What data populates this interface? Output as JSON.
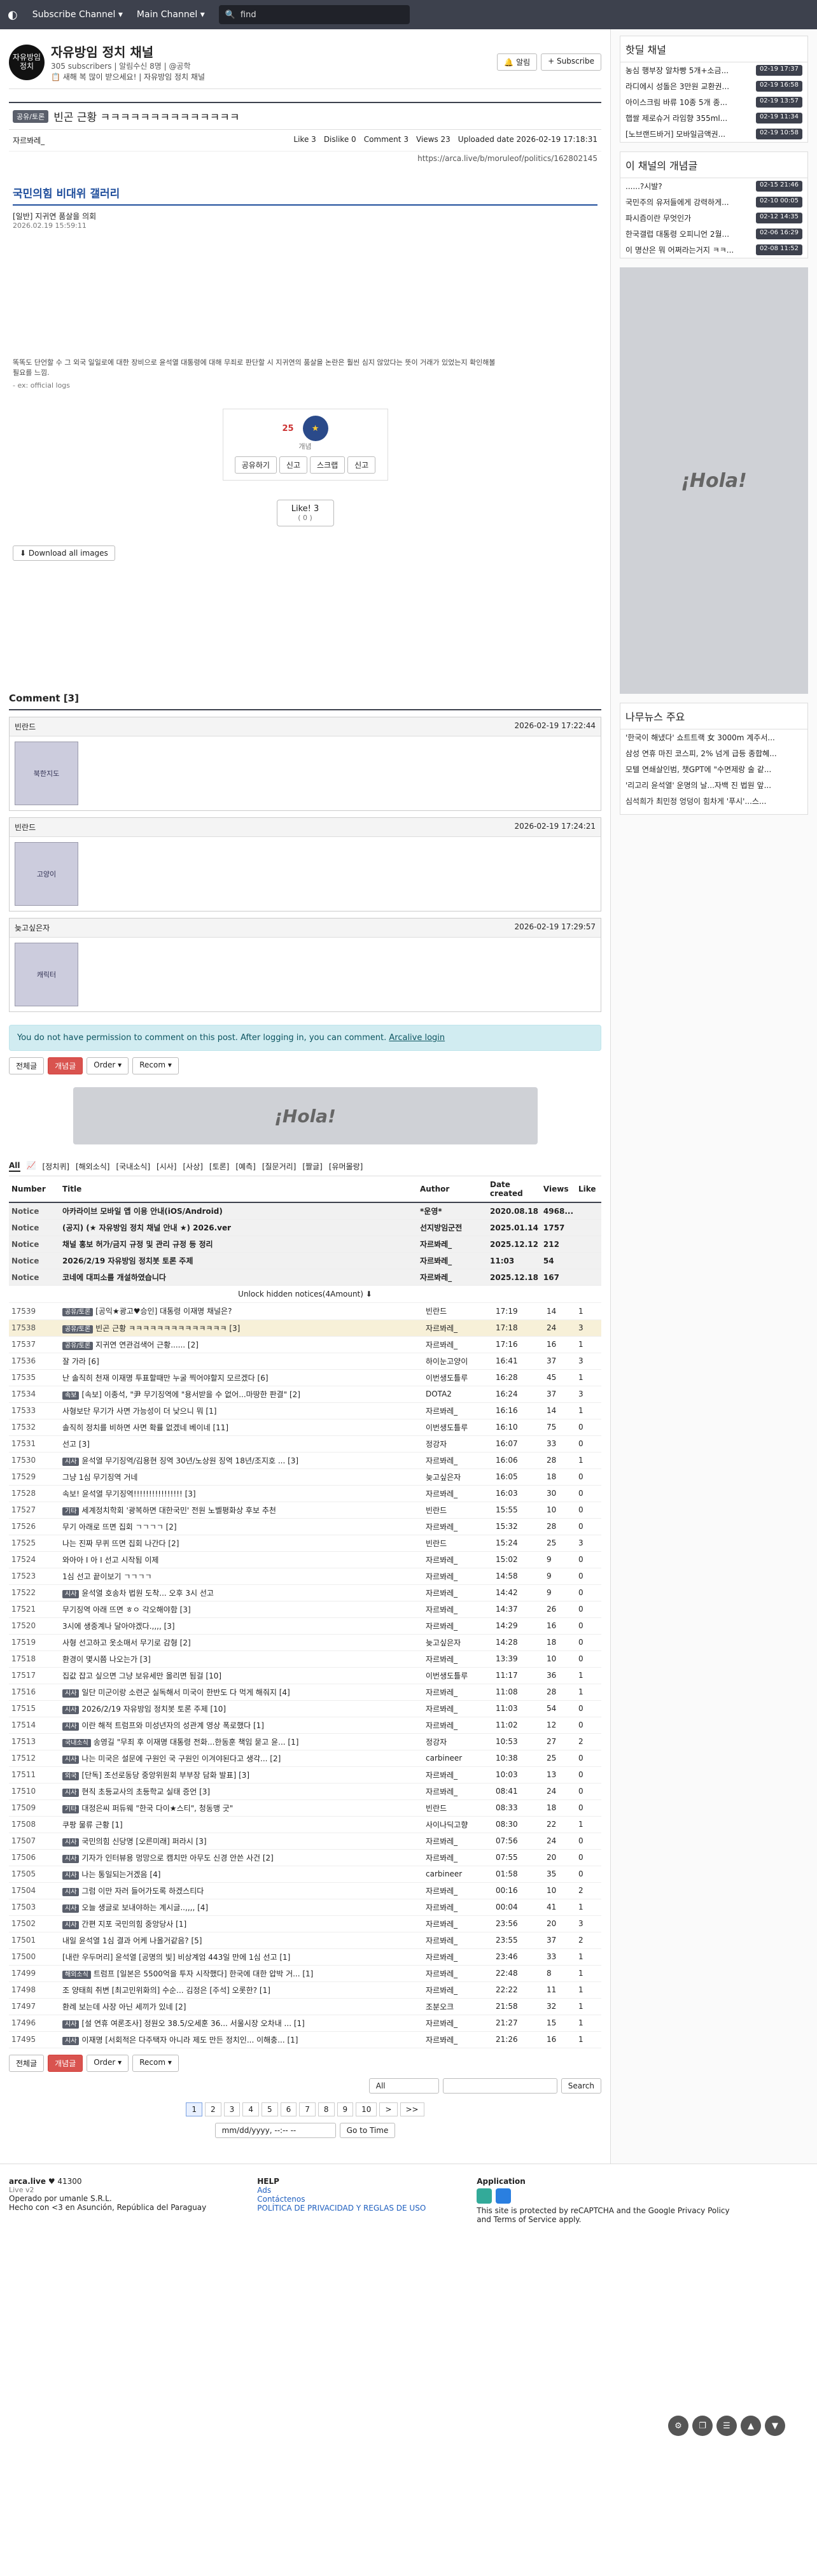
{
  "topbar": {
    "logo": "arca.live",
    "menu1": "Subscribe Channel ▾",
    "menu2": "Main Channel ▾",
    "search_placeholder": "find"
  },
  "channel": {
    "logo_text": "자유방임\n정치",
    "title": "자유방임 정치 채널",
    "subscribers": "305 subscribers",
    "sub_extra": "알림수신 8명 | @공학",
    "desc": "새해 복 많이 받으세요! | 자유방임 정치 채널",
    "alarm_btn": "알림",
    "subscribe_btn": "+ Subscribe"
  },
  "article": {
    "badge": "공유/토론",
    "title": "빈곤 근황 ㅋㅋㅋㅋㅋㅋㅋㅋㅋㅋㅋㅋㅋㅋ",
    "author": "자르봐레_",
    "like_label": "Like",
    "like_count": "3",
    "dislike_label": "Dislike",
    "dislike_count": "0",
    "comment_label": "Comment",
    "comment_count": "3",
    "views_label": "Views",
    "views_count": "23",
    "uploaded_label": "Uploaded date",
    "uploaded": "2026-02-19 17:18:31",
    "url": "https://arca.live/b/moruleof/politics/162802145",
    "inner_title": "국민의힘 비대위 갤러리",
    "inner_sub": "[일반] 지귀연 품살을 의회",
    "inner_date": "2026.02.19 15:59:11",
    "inner_text": "똑똑도 단언할 수 그 외국 일일로에 대한 장비으로 윤석열 대통령에 대해 무죄로 판단할 시 지귀연의 품살을 논란은 훨씬 심지 않았다는 뜻이 거래가 있었는지 확인해볼 필요를 느낌.",
    "inner_src": "- ex: official logs",
    "vote_num": "25",
    "vote_label": "개념",
    "vote_btns": [
      "공유하기",
      "신고",
      "스크랩",
      "신고"
    ],
    "like_box_label": "Like!",
    "like_box_count": "3",
    "like_box_sub": "( 0 )",
    "download_btn": "Download all images"
  },
  "comments": {
    "title": "Comment [3]",
    "items": [
      {
        "author": "빈란드",
        "date": "2026-02-19 17:22:44",
        "img": "북한지도"
      },
      {
        "author": "빈란드",
        "date": "2026-02-19 17:24:21",
        "img": "고양이"
      },
      {
        "author": "늦고싶은자",
        "date": "2026-02-19 17:29:57",
        "img": "캐릭터"
      }
    ],
    "alert": "You do not have permission to comment on this post. After logging in, you can comment.",
    "alert_link": "Arcalive login"
  },
  "toolbar": {
    "all": "전체글",
    "concept": "개념글",
    "order": "Order ▾",
    "recom": "Recom ▾"
  },
  "ad_text": "¡Hola!",
  "categories": [
    "All",
    "📈",
    "[정치퀴]",
    "[해외소식]",
    "[국내소식]",
    "[시사]",
    "[사상]",
    "[토론]",
    "[예측]",
    "[질문거리]",
    "[짤글]",
    "[유머몰랑]"
  ],
  "table": {
    "headers": [
      "Number",
      "Title",
      "Author",
      "Date created",
      "Views",
      "Like"
    ],
    "notices": [
      {
        "num": "Notice",
        "title": "아카라이브 모바일 앱 이용 안내(iOS/Android)",
        "author": "*운영*",
        "date": "2020.08.18",
        "views": "4968...",
        "like": ""
      },
      {
        "num": "Notice",
        "title": "(공지) (★ 자유방임 정치 채널 안내 ★) 2026.ver",
        "author": "선지방임군전",
        "date": "2025.01.14",
        "views": "1757",
        "like": ""
      },
      {
        "num": "Notice",
        "title": "채널 홍보 허가/금지 규정 및 관리 규정 등 정리",
        "author": "자르봐레_",
        "date": "2025.12.12",
        "views": "212",
        "like": ""
      },
      {
        "num": "Notice",
        "title": "2026/2/19 자유방임 정치봇 토론 주제",
        "author": "자르봐레_",
        "date": "11:03",
        "views": "54",
        "like": ""
      },
      {
        "num": "Notice",
        "title": "코네에 대피소를 개설하였습니다",
        "author": "자르봐레_",
        "date": "2025.12.18",
        "views": "167",
        "like": ""
      }
    ],
    "unlock": "Unlock hidden notices(4Amount) ⬇",
    "rows": [
      {
        "num": "17539",
        "tag": "공유/토론",
        "title": "[공익★광고♥승인] 대통령 이재명 채널은?",
        "author": "빈란드",
        "date": "17:19",
        "views": "14",
        "like": "1"
      },
      {
        "num": "17538",
        "tag": "공유/토론",
        "title": "빈곤 근황 ㅋㅋㅋㅋㅋㅋㅋㅋㅋㅋㅋㅋㅋㅋ [3]",
        "author": "자르봐레_",
        "date": "17:18",
        "views": "24",
        "like": "3",
        "hl": true
      },
      {
        "num": "17537",
        "tag": "공유/토론",
        "title": "지귀연 연관검색어 근황...... [2]",
        "author": "자르봐레_",
        "date": "17:16",
        "views": "16",
        "like": "1"
      },
      {
        "num": "17536",
        "tag": "",
        "title": "잘 가라 [6]",
        "author": "하이눈고양이",
        "date": "16:41",
        "views": "37",
        "like": "3"
      },
      {
        "num": "17535",
        "tag": "",
        "title": "난 솔직히 천재 이재명 투표할때만 누굴 찍어야할지 모르겠다 [6]",
        "author": "이번생도틀루",
        "date": "16:28",
        "views": "45",
        "like": "1"
      },
      {
        "num": "17534",
        "tag": "속보",
        "title": "[속보] 이종석, \"尹 무기징역에 \"용서받을 수 없어...마땅한 판결\" [2]",
        "author": "DOTA2",
        "date": "16:24",
        "views": "37",
        "like": "3"
      },
      {
        "num": "17533",
        "tag": "",
        "title": "사형보단 무기가 사면 가능성이 더 낮으니 뭐 [1]",
        "author": "자르봐레_",
        "date": "16:16",
        "views": "14",
        "like": "1"
      },
      {
        "num": "17532",
        "tag": "",
        "title": "솔직히 정치를 비하면 사면 확률 없겠네 베이네 [11]",
        "author": "이번생도틀루",
        "date": "16:10",
        "views": "75",
        "like": "0"
      },
      {
        "num": "17531",
        "tag": "",
        "title": "선고 [3]",
        "author": "정강자",
        "date": "16:07",
        "views": "33",
        "like": "0"
      },
      {
        "num": "17530",
        "tag": "시사",
        "title": "윤석열 무기징역/김용현 징역 30년/노상원 징역 18년/조지호 ... [3]",
        "author": "자르봐레_",
        "date": "16:06",
        "views": "28",
        "like": "1"
      },
      {
        "num": "17529",
        "tag": "",
        "title": "그냥 1심 무기징역 거네",
        "author": "늦고싶은자",
        "date": "16:05",
        "views": "18",
        "like": "0"
      },
      {
        "num": "17528",
        "tag": "",
        "title": "속보! 윤석열 무기징역!!!!!!!!!!!!!!!! [3]",
        "author": "자르봐레_",
        "date": "16:03",
        "views": "30",
        "like": "0"
      },
      {
        "num": "17527",
        "tag": "기타",
        "title": "세계정치학회 '광복하면 대한국민' 전원 노벨평화상 후보 추천",
        "author": "빈란드",
        "date": "15:55",
        "views": "10",
        "like": "0"
      },
      {
        "num": "17526",
        "tag": "",
        "title": "무기 아래로 뜨면 집회 ㄱㄱㄱㄱ [2]",
        "author": "자르봐레_",
        "date": "15:32",
        "views": "28",
        "like": "0"
      },
      {
        "num": "17525",
        "tag": "",
        "title": "나는 진짜 무퀴 뜨면 집회 나간다 [2]",
        "author": "빈란드",
        "date": "15:24",
        "views": "25",
        "like": "3"
      },
      {
        "num": "17524",
        "tag": "",
        "title": "와아아 I 아 I 선고 시작됨 이제",
        "author": "자르봐레_",
        "date": "15:02",
        "views": "9",
        "like": "0"
      },
      {
        "num": "17523",
        "tag": "",
        "title": "1심 선고 끝이보기 ㄱㄱㄱㄱ",
        "author": "자르봐레_",
        "date": "14:58",
        "views": "9",
        "like": "0"
      },
      {
        "num": "17522",
        "tag": "시사",
        "title": "윤석열 호송차 법원 도착... 오후 3시 선고",
        "author": "자르봐레_",
        "date": "14:42",
        "views": "9",
        "like": "0"
      },
      {
        "num": "17521",
        "tag": "",
        "title": "무기징역 아래 뜨면 ㅎㅇ 각오해야함 [3]",
        "author": "자르봐레_",
        "date": "14:37",
        "views": "26",
        "like": "0"
      },
      {
        "num": "17520",
        "tag": "",
        "title": "3시에 생중계나 달아야겠다.,,,, [3]",
        "author": "자르봐레_",
        "date": "14:29",
        "views": "16",
        "like": "0"
      },
      {
        "num": "17519",
        "tag": "",
        "title": "사형 선고하고 옷소매서 무기로 감형 [2]",
        "author": "늦고싶은자",
        "date": "14:28",
        "views": "18",
        "like": "0"
      },
      {
        "num": "17518",
        "tag": "",
        "title": "환경이 몇시쯤 나오는가 [3]",
        "author": "자르봐레_",
        "date": "13:39",
        "views": "10",
        "like": "0"
      },
      {
        "num": "17517",
        "tag": "",
        "title": "집값 잡고 싶으면 그냥 보유세만 올리면 됨걸 [10]",
        "author": "이번생도틀루",
        "date": "11:17",
        "views": "36",
        "like": "1"
      },
      {
        "num": "17516",
        "tag": "시사",
        "title": "일단 미군이랑 소련군 실독해서 미국이 한반도 다 먹게 해줘지 [4]",
        "author": "자르봐레_",
        "date": "11:08",
        "views": "28",
        "like": "1"
      },
      {
        "num": "17515",
        "tag": "시사",
        "title": "2026/2/19 자유방임 정치봇 토론 주제 [10]",
        "author": "자르봐레_",
        "date": "11:03",
        "views": "54",
        "like": "0"
      },
      {
        "num": "17514",
        "tag": "시사",
        "title": "이란 해적 트럼프와 미성년자의 성관계 영상 폭로했다 [1]",
        "author": "자르봐레_",
        "date": "11:02",
        "views": "12",
        "like": "0"
      },
      {
        "num": "17513",
        "tag": "국내소식",
        "title": "송영길 \"무죄 후 이재명 대통령 전화...한동훈 책임 묻고 윤... [1]",
        "author": "정강자",
        "date": "10:53",
        "views": "27",
        "like": "2"
      },
      {
        "num": "17512",
        "tag": "시사",
        "title": "나는 미국은 설문에 구원인 국 구원인 이겨야된다고 생각... [2]",
        "author": "carbineer",
        "date": "10:38",
        "views": "25",
        "like": "0"
      },
      {
        "num": "17511",
        "tag": "외국",
        "title": "[단독] 조선로동당 중앙위원회 부부장 담화 발표] [3]",
        "author": "자르봐레_",
        "date": "10:03",
        "views": "13",
        "like": "0"
      },
      {
        "num": "17510",
        "tag": "시사",
        "title": "현직 초등교사의 초등학교 실태 증언 [3]",
        "author": "자르봐레_",
        "date": "08:41",
        "views": "24",
        "like": "0"
      },
      {
        "num": "17509",
        "tag": "기타",
        "title": "대정은씨 퍼듀웨 \"한국 다이★스티\", 청동맹 굿\"",
        "author": "빈란드",
        "date": "08:33",
        "views": "18",
        "like": "0"
      },
      {
        "num": "17508",
        "tag": "",
        "title": "쿠팡 물류 근황 [1]",
        "author": "사이나딕고향",
        "date": "08:30",
        "views": "22",
        "like": "1"
      },
      {
        "num": "17507",
        "tag": "시사",
        "title": "국민의힘 신당명 [오른미래] 퍼라시 [3]",
        "author": "자르봐레_",
        "date": "07:56",
        "views": "24",
        "like": "0"
      },
      {
        "num": "17506",
        "tag": "시사",
        "title": "기자가 인터뷰용 멍망으로 캠치만 아무도 신경 안쓴 사건 [2]",
        "author": "자르봐레_",
        "date": "07:55",
        "views": "20",
        "like": "0"
      },
      {
        "num": "17505",
        "tag": "시사",
        "title": "나는 통일되는거겠음 [4]",
        "author": "carbineer",
        "date": "01:58",
        "views": "35",
        "like": "0"
      },
      {
        "num": "17504",
        "tag": "시사",
        "title": "그럼 이만 자러 들어가도록 하겠스티다",
        "author": "자르봐레_",
        "date": "00:16",
        "views": "10",
        "like": "2"
      },
      {
        "num": "17503",
        "tag": "시사",
        "title": "오늘 생글로 보내야하는 계시글..,,,, [4]",
        "author": "자르봐레_",
        "date": "00:04",
        "views": "41",
        "like": "1"
      },
      {
        "num": "17502",
        "tag": "시사",
        "title": "간편 지포 국민의힘 중앙당사 [1]",
        "author": "자르봐레_",
        "date": "23:56",
        "views": "20",
        "like": "3"
      },
      {
        "num": "17501",
        "tag": "",
        "title": "내일 윤석열 1심 결과 어케 나올거같음? [5]",
        "author": "자르봐레_",
        "date": "23:55",
        "views": "37",
        "like": "2"
      },
      {
        "num": "17500",
        "tag": "",
        "title": "[내란 우두머리] 윤석열 [공명의 빛] 비상계엄 443일 만에 1심 선고 [1]",
        "author": "자르봐레_",
        "date": "23:46",
        "views": "33",
        "like": "1"
      },
      {
        "num": "17499",
        "tag": "해외소식",
        "title": "트럼프 [일본은 5500억을 투자 시작했다] 한국에 대한 압박 거... [1]",
        "author": "자르봐레_",
        "date": "22:48",
        "views": "8",
        "like": "1"
      },
      {
        "num": "17498",
        "tag": "",
        "title": "조 양태희 취변 [최고민위화의] 수순... 김정은 [주석] 오롯한? [1]",
        "author": "자르봐레_",
        "date": "22:22",
        "views": "11",
        "like": "1"
      },
      {
        "num": "17497",
        "tag": "",
        "title": "환례 보는데 사장 아닌 세끼가 있네 [2]",
        "author": "조분오크",
        "date": "21:58",
        "views": "32",
        "like": "1"
      },
      {
        "num": "17496",
        "tag": "시사",
        "title": "[설 연휴 여론조사] 정원오 38.5/오세훈 36... 서울시장 오차내 ... [1]",
        "author": "자르봐레_",
        "date": "21:27",
        "views": "15",
        "like": "1"
      },
      {
        "num": "17495",
        "tag": "시사",
        "title": "이재명 [서회적은 다주택자 아니라 제도 만든 정치인... 이해충... [1]",
        "author": "자르봐레_",
        "date": "21:26",
        "views": "16",
        "like": "1"
      }
    ]
  },
  "search": {
    "select": "All",
    "button": "Search",
    "goto": "Go to Time",
    "date_placeholder": "mm/dd/yyyy, --:-- --"
  },
  "pager": [
    "1",
    "2",
    "3",
    "4",
    "5",
    "6",
    "7",
    "8",
    "9",
    "10",
    ">",
    ">>"
  ],
  "side": {
    "hot_title": "핫딜 채널",
    "hot": [
      {
        "t": "농심 행부장 알차빵 5개+소금...",
        "d": "02-19 17:37"
      },
      {
        "t": "라디에시 성돌은 3만원 교환권...",
        "d": "02-19 16:58"
      },
      {
        "t": "아이스크림 바류 10종 5개 종...",
        "d": "02-19 13:57"
      },
      {
        "t": "햅쌀 제로슈거 라임향 355ml...",
        "d": "02-19 11:34"
      },
      {
        "t": "[노브랜드바거] 모바일금액권...",
        "d": "02-19 10:58"
      }
    ],
    "concept_title": "이 채널의 개념글",
    "concept": [
      {
        "t": "......?시발?",
        "d": "02-15 21:46"
      },
      {
        "t": "국민주의 유저들에게 강력하게...",
        "d": "02-10 00:05"
      },
      {
        "t": "파시즘이란 무엇인가",
        "d": "02-12 14:35"
      },
      {
        "t": "한국갤럽 대통령 오피니언 2월...",
        "d": "02-06 16:29"
      },
      {
        "t": "이 명산은 뭐 어쩌라는거지 ㅋㅋ...",
        "d": "02-08 11:52"
      }
    ],
    "ad_text": "¡Hola!",
    "news_title": "나무뉴스 주요",
    "news": [
      "'한국이 해냈다' 쇼트트랙 女 3000m 계주서...",
      "삼성 연휴 마진 코스피, 2% 넘게 급등 종합혜...",
      "모텔 연쇄살인범, 챗GPT에 \"수면제랑 술 같...",
      "'리고리 윤석열' 운명의 날...자백 진 법원 앞...",
      "심석희가 최민정 엉덩이 힘차게 '푸시'...스...",
      ""
    ]
  },
  "footer": {
    "brand": "arca.live",
    "brand_count": "♥ 41300",
    "version": "Live v2",
    "operator": "Operado por umanle S.R.L.",
    "made": "Hecho con <3 en Asunción, República del Paraguay",
    "help": "HELP",
    "ads": "Ads",
    "contact": "Contáctenos",
    "policy": "POLÍTICA DE PRIVACIDAD Y REGLAS DE USO",
    "app": "Application",
    "recaptcha": "This site is protected by reCAPTCHA and the Google Privacy Policy and Terms of Service apply."
  }
}
